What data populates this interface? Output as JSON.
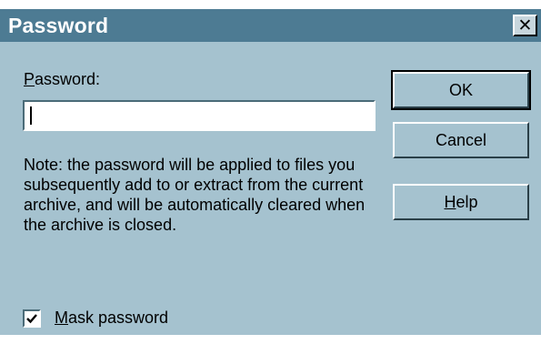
{
  "window": {
    "title": "Password",
    "close_glyph": "✕"
  },
  "form": {
    "password_label_mnemonic": "P",
    "password_label_rest": "assword:",
    "password_value": "",
    "note": "Note:  the password will be applied to files you subsequently add to or extract from the current archive, and will be automatically cleared when the archive is closed."
  },
  "buttons": {
    "ok": "OK",
    "cancel": "Cancel",
    "help_mnemonic": "H",
    "help_rest": "elp"
  },
  "mask": {
    "checked": true,
    "label_mnemonic": "M",
    "label_rest": "ask password"
  },
  "colors": {
    "titlebar": "#4d7b93",
    "dialog_bg": "#a5c2cf"
  }
}
